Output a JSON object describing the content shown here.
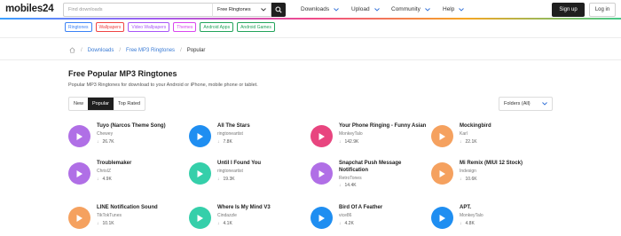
{
  "header": {
    "logo": "mobiles24",
    "search_placeholder": "Find downloads",
    "search_category": "Free Ringtones",
    "nav": [
      "Downloads",
      "Upload",
      "Community",
      "Help"
    ],
    "signup": "Sign up",
    "login": "Log in"
  },
  "categories": [
    {
      "label": "Ringtones",
      "color": "#3b82f6"
    },
    {
      "label": "Wallpapers",
      "color": "#ef4444"
    },
    {
      "label": "Video Wallpapers",
      "color": "#a855f7"
    },
    {
      "label": "Themes",
      "color": "#d946ef"
    },
    {
      "label": "Android Apps",
      "color": "#22a35a"
    },
    {
      "label": "Android Games",
      "color": "#22a35a"
    }
  ],
  "breadcrumb": {
    "home_icon": "home-icon",
    "items": [
      "Downloads",
      "Free MP3 Ringtones"
    ],
    "current": "Popular"
  },
  "page": {
    "title": "Free Popular MP3 Ringtones",
    "description": "Popular MP3 Ringtones for download to your Android or iPhone, mobile phone or tablet."
  },
  "tabs": [
    {
      "label": "New",
      "active": false
    },
    {
      "label": "Popular",
      "active": true
    },
    {
      "label": "Top Rated",
      "active": false
    }
  ],
  "folders_select": "Folders (All)",
  "ringtones": [
    {
      "title": "Tuyo (Narcos Theme Song)",
      "artist": "Chewey",
      "downloads": "26.7K",
      "color": "#b06fe6"
    },
    {
      "title": "All The Stars",
      "artist": "ringtoneartist",
      "downloads": "7.8K",
      "color": "#1f8ef1"
    },
    {
      "title": "Your Phone Ringing - Funny Asian",
      "artist": "MonkeyTalo",
      "downloads": "142.9K",
      "color": "#e8457f"
    },
    {
      "title": "Mockingbird",
      "artist": "Karl",
      "downloads": "22.1K",
      "color": "#f5a15f"
    },
    {
      "title": "Troublemaker",
      "artist": "ChrisIZ",
      "downloads": "4.9K",
      "color": "#b06fe6"
    },
    {
      "title": "Until I Found You",
      "artist": "ringtoneartist",
      "downloads": "19.3K",
      "color": "#35cfaa"
    },
    {
      "title": "Snapchat Push Message Notification",
      "artist": "RetroTones",
      "downloads": "14.4K",
      "color": "#b06fe6"
    },
    {
      "title": "Mi Remix (MIUI 12 Stock)",
      "artist": "Indesign",
      "downloads": "10.6K",
      "color": "#f5a15f"
    },
    {
      "title": "LINE Notification Sound",
      "artist": "TikTokTunes",
      "downloads": "10.1K",
      "color": "#f5a15f"
    },
    {
      "title": "Where Is My Mind V3",
      "artist": "Cindazzle",
      "downloads": "4.1K",
      "color": "#35cfaa"
    },
    {
      "title": "Bird Of A Feather",
      "artist": "vice86",
      "downloads": "4.2K",
      "color": "#1f8ef1"
    },
    {
      "title": "APT.",
      "artist": "MonkeyTalo",
      "downloads": "4.8K",
      "color": "#1f8ef1"
    }
  ]
}
